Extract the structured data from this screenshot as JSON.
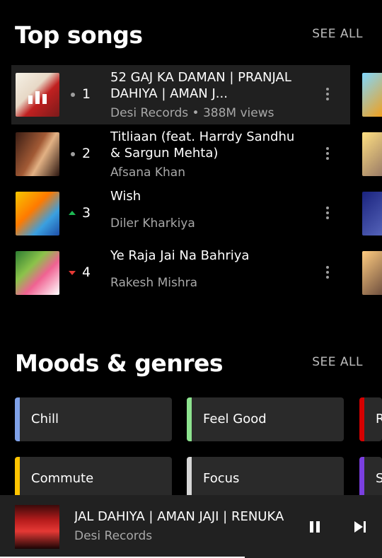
{
  "top_songs": {
    "title": "Top songs",
    "see_all": "SEE ALL",
    "items": [
      {
        "rank": "1",
        "title": "52 GAJ KA DAMAN | PRANJAL DAHIYA | AMAN J...",
        "subtitle": "Desi Records • 388M views",
        "trend": "same",
        "active": true
      },
      {
        "rank": "2",
        "title": "Titliaan (feat. Harrdy Sandhu & Sargun Mehta)",
        "subtitle": "Afsana Khan",
        "trend": "same"
      },
      {
        "rank": "3",
        "title": "Wish",
        "subtitle": "Diler Kharkiya",
        "trend": "up"
      },
      {
        "rank": "4",
        "title": "Ye Raja Jai Na Bahriya",
        "subtitle": "Rakesh Mishra",
        "trend": "down"
      }
    ]
  },
  "moods": {
    "title": "Moods & genres",
    "see_all": "SEE ALL",
    "chips": [
      {
        "label": "Chill",
        "color": "#7fa1e8"
      },
      {
        "label": "Feel Good",
        "color": "#8de38f"
      },
      {
        "label": "R",
        "color": "#d50000"
      },
      {
        "label": "Commute",
        "color": "#ffc400"
      },
      {
        "label": "Focus",
        "color": "#d6d6d6"
      },
      {
        "label": "S",
        "color": "#7a3fe0"
      }
    ]
  },
  "player": {
    "title": "JAL DAHIYA | AMAN JAJI | RENUKA",
    "subtitle": "Desi Records",
    "progress_fraction": 0.64
  },
  "colors": {
    "trend_up": "#1db954",
    "trend_down": "#e53935",
    "trend_same": "#9e9e9e"
  }
}
